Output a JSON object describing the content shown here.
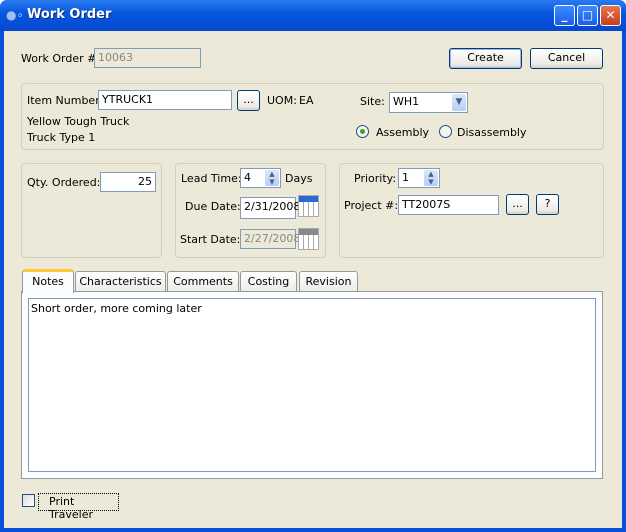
{
  "window": {
    "title": "Work Order"
  },
  "header": {
    "wo_label": "Work Order #:",
    "wo_value": "10063",
    "create": "Create",
    "cancel": "Cancel"
  },
  "item": {
    "label": "Item Number:",
    "value": "YTRUCK1",
    "lookup": "...",
    "uom_label": "UOM:",
    "uom_value": "EA",
    "desc1": "Yellow Tough Truck",
    "desc2": "Truck Type 1",
    "site_label": "Site:",
    "site_value": "WH1",
    "assembly": "Assembly",
    "disassembly": "Disassembly",
    "mode": "Assembly"
  },
  "qty": {
    "label": "Qty. Ordered:",
    "value": "25"
  },
  "schedule": {
    "lead_label": "Lead Time:",
    "lead_value": "4",
    "days": "Days",
    "due_label": "Due Date:",
    "due_value": "2/31/2008",
    "start_label": "Start Date:",
    "start_value": "2/27/2008"
  },
  "priority": {
    "label": "Priority:",
    "value": "1",
    "project_label": "Project #:",
    "project_value": "TT2007S",
    "lookup": "...",
    "help": "?"
  },
  "tabs": [
    {
      "label": "Notes"
    },
    {
      "label": "Characteristics"
    },
    {
      "label": "Comments"
    },
    {
      "label": "Costing"
    },
    {
      "label": "Revision"
    }
  ],
  "notes": {
    "text": "Short order, more coming later"
  },
  "footer": {
    "print_traveler": "Print Traveler",
    "checked": false
  }
}
